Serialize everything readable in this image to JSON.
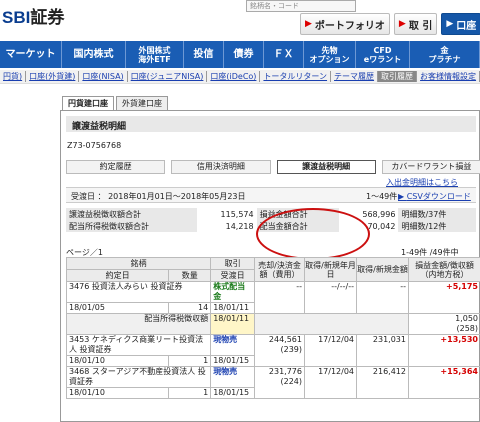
{
  "header": {
    "logo": "SBI",
    "logo_suffix": "証券",
    "search_placeholder": "銘柄名・コード",
    "buttons": [
      {
        "label": "ポートフォリオ"
      },
      {
        "label": "取 引"
      },
      {
        "label": "口座"
      }
    ]
  },
  "nav": {
    "items": [
      "マーケット",
      "国内株式",
      "外国株式\n海外ETF",
      "投信",
      "債券",
      "ＦＸ",
      "先物\nオプション",
      "CFD\neワラント",
      "金\nプラチナ"
    ]
  },
  "subnav": {
    "items": [
      "円貨)",
      "口座(外貨建)",
      "口座(NISA)",
      "口座(ジュニアNISA)",
      "口座(iDeCo)",
      "トータルリターン",
      "テーマ履歴",
      "取引履歴",
      "お客様情報設定"
    ],
    "active_index": 7
  },
  "panel": {
    "tabs": [
      "円貨建口座",
      "外貨建口座"
    ],
    "title": "譲渡益税明細",
    "account": "Z73-0756768",
    "buttons": [
      "約定履歴",
      "信用決済明細",
      "譲渡益税明細",
      "カバードワラント損益"
    ],
    "active_button": 2,
    "all_link": "入出金明細はこちら",
    "period": "受渡日 ： 2018年01月01日～2018年05月23日",
    "count": "1～49件",
    "csv": "CSVダウンロード",
    "summary": {
      "row1": {
        "l1": "譲渡益税徴収額合計",
        "v1": "115,574",
        "l2": "損益金額合計",
        "v2": "568,996",
        "l3": "明細数/37件"
      },
      "row2": {
        "l1": "配当所得税徴収額合計",
        "v1": "14,218",
        "l2": "配当金額合計",
        "v2": "70,042",
        "l3": "明細数/12件"
      }
    },
    "page_label": "ページ／1",
    "pager": "1-49件 /49件中",
    "columns": {
      "c1": "銘柄",
      "c1a": "約定日",
      "c1b": "数量",
      "c2": "取引",
      "c2a": "受渡日",
      "c3": "売却/決済金額（費用）",
      "c4": "取得/新規年月日",
      "c5": "取得/新規金額",
      "c6": "損益金額/徴収額（内地方税）"
    },
    "rows": [
      {
        "name": "3476 投資法人みらい 投資証券",
        "date": "18/01/05",
        "qty": "14",
        "trade": "株式配当金",
        "settle": "18/01/11",
        "amount": "--",
        "fee": "--",
        "acq_date": "--/--/--",
        "acq_amt": "--",
        "pl": "+5,175",
        "tax": ""
      },
      {
        "name": "配当所得税徴収額",
        "date": "",
        "qty": "",
        "trade": "",
        "settle": "18/01/11",
        "amount": "",
        "fee": "",
        "acq_date": "",
        "acq_amt": "",
        "pl": "1,050",
        "tax": "(258)"
      },
      {
        "name": "3453 ケネディクス商業リート投資法人 投資証券",
        "date": "18/01/10",
        "qty": "1",
        "trade": "現物売",
        "settle": "18/01/15",
        "amount": "244,561",
        "fee": "(239)",
        "acq_date": "17/12/04",
        "acq_amt": "231,031",
        "pl": "+13,530",
        "tax": ""
      },
      {
        "name": "3468 スターアジア不動産投資法人 投資証券",
        "date": "18/01/10",
        "qty": "1",
        "trade": "現物売",
        "settle": "18/01/15",
        "amount": "231,776",
        "fee": "(224)",
        "acq_date": "17/12/04",
        "acq_amt": "216,412",
        "pl": "+15,364",
        "tax": ""
      }
    ]
  }
}
